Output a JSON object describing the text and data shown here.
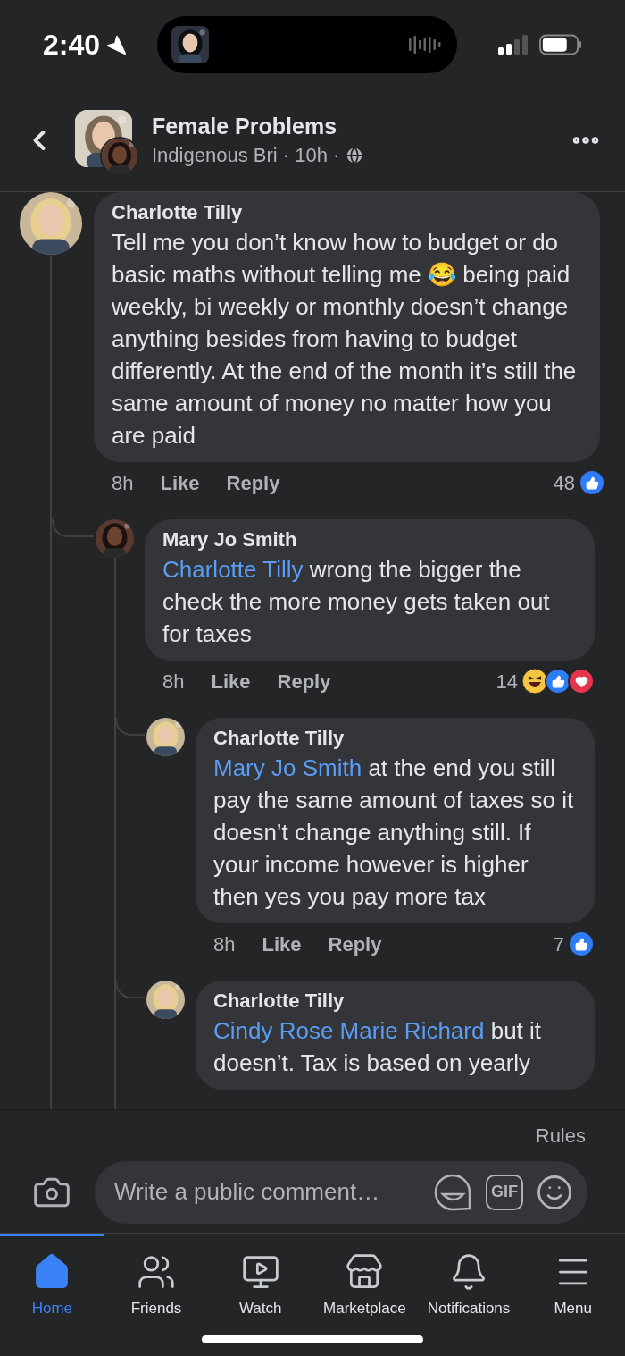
{
  "status_bar": {
    "time": "2:40"
  },
  "header": {
    "title": "Female Problems",
    "subtitle": "Indigenous Bri · 10h ·"
  },
  "comments": [
    {
      "author": "Charlotte Tilly",
      "text": "Tell me you don’t know how to budget or do basic maths without telling me 😂 being paid weekly, bi weekly or monthly doesn’t change anything besides from having to budget differently. At the end of the month it’s still the same amount of money no matter how you are paid",
      "time": "8h",
      "like": "Like",
      "reply": "Reply",
      "reaction_count": "48",
      "reactions": [
        {
          "kind": "like"
        }
      ],
      "children": [
        {
          "author": "Mary Jo Smith",
          "mention": "Charlotte Tilly",
          "text": "wrong the bigger the check the more money gets taken out for taxes",
          "time": "8h",
          "like": "Like",
          "reply": "Reply",
          "reaction_count": "14",
          "reactions": [
            {
              "kind": "haha"
            },
            {
              "kind": "like"
            },
            {
              "kind": "love"
            }
          ],
          "children": [
            {
              "author": "Charlotte Tilly",
              "mention": "Mary Jo Smith",
              "text": "at the end you still pay the same amount of taxes so it doesn’t change anything still. If your income however is higher then yes you pay more tax",
              "time": "8h",
              "like": "Like",
              "reply": "Reply",
              "reaction_count": "7",
              "reactions": [
                {
                  "kind": "like"
                }
              ]
            },
            {
              "author": "Charlotte Tilly",
              "mention": "Cindy Rose Marie Richard",
              "text": "but it doesn’t. Tax is based on yearly"
            }
          ]
        }
      ]
    }
  ],
  "footer": {
    "rules": "Rules",
    "placeholder": "Write a public comment…",
    "gif_label": "GIF"
  },
  "tabs": [
    {
      "label": "Home",
      "kind": "home",
      "selected": true
    },
    {
      "label": "Friends",
      "kind": "friends",
      "selected": false
    },
    {
      "label": "Watch",
      "kind": "watch",
      "selected": false
    },
    {
      "label": "Marketplace",
      "kind": "marketplace",
      "selected": false
    },
    {
      "label": "Notifications",
      "kind": "notifications",
      "selected": false
    },
    {
      "label": "Menu",
      "kind": "menu",
      "selected": false
    }
  ]
}
